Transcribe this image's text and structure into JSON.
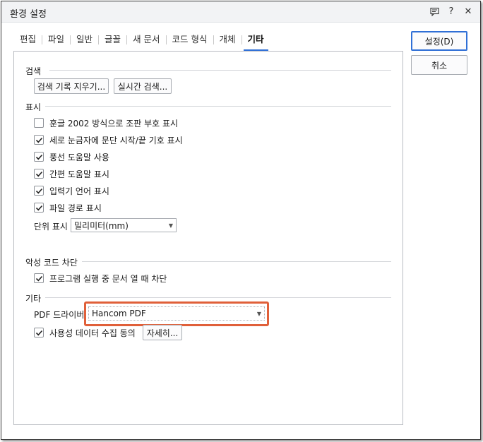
{
  "window": {
    "title": "환경 설정"
  },
  "titlebar_icons": [
    "comment-icon",
    "help-icon",
    "close-icon"
  ],
  "titlebar_glyphs": {
    "help": "?",
    "close": "✕"
  },
  "tabs": [
    {
      "label": "편집"
    },
    {
      "label": "파일"
    },
    {
      "label": "일반"
    },
    {
      "label": "글꼴"
    },
    {
      "label": "새 문서"
    },
    {
      "label": "코드 형식"
    },
    {
      "label": "개체"
    },
    {
      "label": "기타",
      "active": true
    }
  ],
  "side_buttons": {
    "ok": "설정(D)",
    "cancel": "취소"
  },
  "search": {
    "title": "검색",
    "clear_history": "검색 기록 지우기...",
    "realtime": "실시간 검색..."
  },
  "display": {
    "title": "표시",
    "options": [
      {
        "label": "훈글 2002 방식으로 조판 부호 표시",
        "checked": false
      },
      {
        "label": "세로 눈금자에 문단 시작/끝 기호 표시",
        "checked": true
      },
      {
        "label": "풍선 도움말 사용",
        "checked": true
      },
      {
        "label": "간편 도움말 표시",
        "checked": true
      },
      {
        "label": "입력기 언어 표시",
        "checked": true
      },
      {
        "label": "파일 경로 표시",
        "checked": true
      }
    ],
    "unit_label": "단위 표시",
    "unit_value": "밀리미터(mm)"
  },
  "malware": {
    "title": "악성 코드 차단",
    "option": {
      "label": "프로그램 실행 중 문서 열 때 차단",
      "checked": true
    }
  },
  "etc": {
    "title": "기타",
    "pdf_label": "PDF 드라이버",
    "pdf_value": "Hancom PDF",
    "usage_label": "사용성 데이터 수집 동의",
    "usage_checked": true,
    "details": "자세히..."
  },
  "colors": {
    "accent": "#2f6fd6",
    "highlight": "#e0603a"
  }
}
